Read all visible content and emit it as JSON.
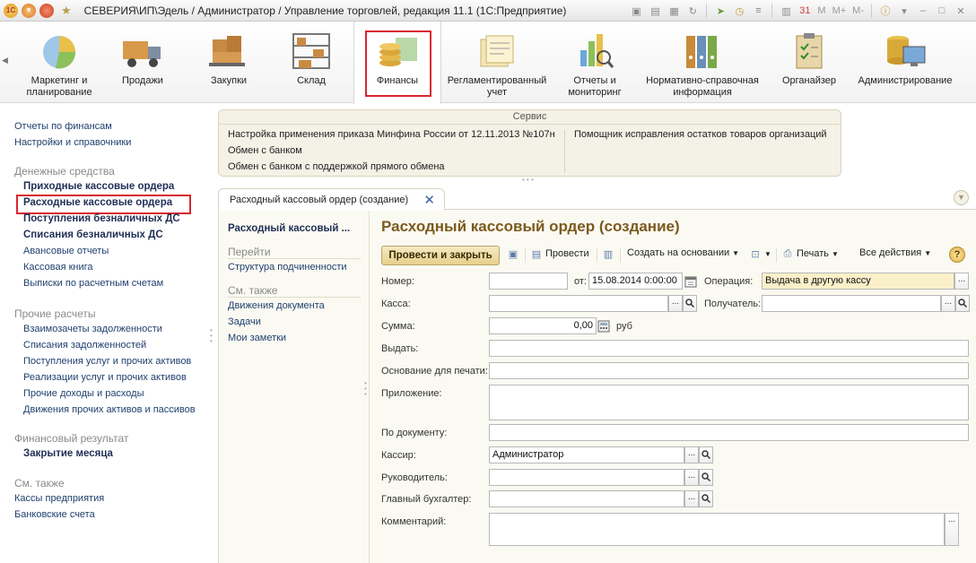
{
  "window": {
    "title": "СЕВЕРИЯ\\ИП\\Эдель / Администратор / Управление торговлей, редакция 11.1  (1С:Предприятие)",
    "tools": [
      "M",
      "M+",
      "M-"
    ]
  },
  "sections": [
    {
      "id": "marketing",
      "label": "Маркетинг и планирование"
    },
    {
      "id": "sales",
      "label": "Продажи"
    },
    {
      "id": "purchases",
      "label": "Закупки"
    },
    {
      "id": "warehouse",
      "label": "Склад"
    },
    {
      "id": "finance",
      "label": "Финансы"
    },
    {
      "id": "regulated",
      "label": "Регламентированный учет"
    },
    {
      "id": "reports",
      "label": "Отчеты и мониторинг"
    },
    {
      "id": "reference",
      "label": "Нормативно-справочная информация"
    },
    {
      "id": "organizer",
      "label": "Органайзер"
    },
    {
      "id": "admin",
      "label": "Администрирование"
    }
  ],
  "leftnav": {
    "top_links": [
      "Отчеты по финансам",
      "Настройки и справочники"
    ],
    "groups": [
      {
        "title": "Денежные средства",
        "items": [
          "Приходные кассовые ордера",
          "Расходные кассовые ордера",
          "Поступления безналичных ДС",
          "Списания безналичных ДС",
          "Авансовые отчеты",
          "Кассовая книга",
          "Выписки по расчетным счетам"
        ]
      },
      {
        "title": "Прочие расчеты",
        "items": [
          "Взаимозачеты задолженности",
          "Списания задолженностей",
          "Поступления услуг и прочих активов",
          "Реализации услуг и прочих активов",
          "Прочие доходы и расходы",
          "Движения прочих активов и пассивов"
        ]
      },
      {
        "title": "Финансовый результат",
        "items": [
          "Закрытие месяца"
        ]
      },
      {
        "title": "См. также",
        "items": [
          "Кассы предприятия",
          "Банковские счета"
        ]
      }
    ]
  },
  "service": {
    "title": "Сервис",
    "col1": [
      "Настройка применения приказа Минфина России от 12.11.2013 №107н",
      "Обмен с банком",
      "Обмен с банком с поддержкой прямого обмена"
    ],
    "col2": [
      "Помощник исправления остатков товаров организаций"
    ]
  },
  "tab": {
    "label": "Расходный кассовый ордер (создание)"
  },
  "formnav": {
    "title": "Расходный кассовый ...",
    "goto_title": "Перейти",
    "goto_items": [
      "Структура подчиненности"
    ],
    "see_title": "См. также",
    "see_items": [
      "Движения документа",
      "Задачи",
      "Мои заметки"
    ]
  },
  "form": {
    "title": "Расходный кассовый ордер (создание)",
    "toolbar": {
      "post_close": "Провести и закрыть",
      "post": "Провести",
      "create_based": "Создать на основании",
      "print": "Печать",
      "all_actions": "Все действия",
      "help": "?"
    },
    "fields": {
      "number_label": "Номер:",
      "number_value": "",
      "date_label": "от:",
      "date_value": "15.08.2014  0:00:00",
      "operation_label": "Операция:",
      "operation_value": "Выдача в другую кассу",
      "cashbox_label": "Касса:",
      "cashbox_value": "",
      "recipient_label": "Получатель:",
      "recipient_value": "",
      "amount_label": "Сумма:",
      "amount_value": "0,00",
      "currency": "руб",
      "issue_label": "Выдать:",
      "issue_value": "",
      "basis_label": "Основание для печати:",
      "basis_value": "",
      "attachment_label": "Приложение:",
      "attachment_value": "",
      "by_doc_label": "По документу:",
      "by_doc_value": "",
      "cashier_label": "Кассир:",
      "cashier_value": "Администратор",
      "head_label": "Руководитель:",
      "head_value": "",
      "chief_acc_label": "Главный бухгалтер:",
      "chief_acc_value": "",
      "comment_label": "Комментарий:",
      "comment_value": ""
    }
  }
}
